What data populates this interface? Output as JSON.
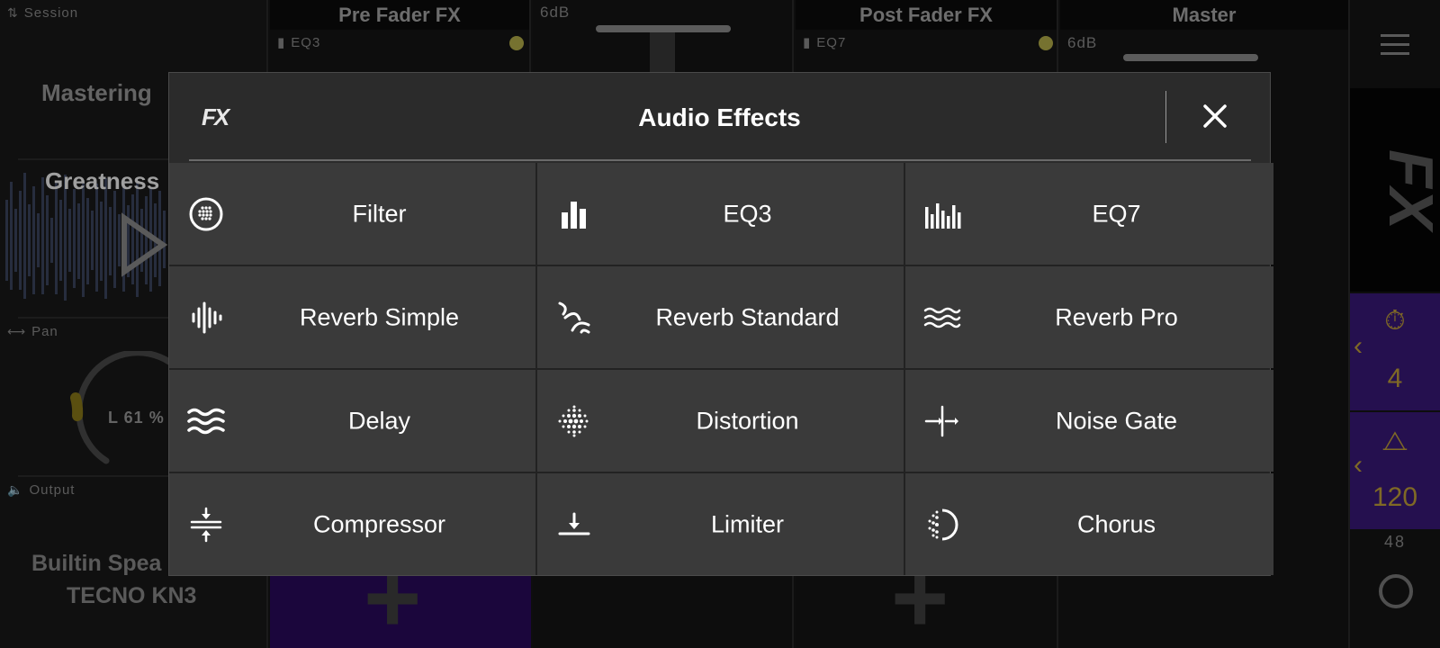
{
  "background": {
    "session_label": "Session",
    "session_name": "Mastering",
    "track_name": "Greatness",
    "pan_label": "Pan",
    "pan_value": "L 61 %",
    "output_label": "Output",
    "output_line1": "Builtin Spea",
    "output_line2": "TECNO KN3",
    "channels": [
      {
        "title": "Pre Fader FX",
        "slot_label": "EQ3"
      },
      {
        "db": "6dB"
      },
      {
        "title": "Post Fader FX",
        "slot_label": "EQ7"
      },
      {
        "title": "Master",
        "db": "6dB"
      }
    ],
    "rail": {
      "timer_value": "4",
      "tempo_value": "120",
      "small_value": "48"
    }
  },
  "modal": {
    "logo": "FX",
    "title": "Audio Effects",
    "close_icon": "close-icon",
    "effects": [
      {
        "label": "Filter",
        "icon": "filter-icon"
      },
      {
        "label": "EQ3",
        "icon": "eq3-icon"
      },
      {
        "label": "EQ7",
        "icon": "eq7-icon"
      },
      {
        "label": "Reverb Simple",
        "icon": "reverb-simple-icon"
      },
      {
        "label": "Reverb Standard",
        "icon": "reverb-standard-icon"
      },
      {
        "label": "Reverb Pro",
        "icon": "reverb-pro-icon"
      },
      {
        "label": "Delay",
        "icon": "delay-icon"
      },
      {
        "label": "Distortion",
        "icon": "distortion-icon"
      },
      {
        "label": "Noise Gate",
        "icon": "noise-gate-icon"
      },
      {
        "label": "Compressor",
        "icon": "compressor-icon"
      },
      {
        "label": "Limiter",
        "icon": "limiter-icon"
      },
      {
        "label": "Chorus",
        "icon": "chorus-icon"
      }
    ]
  },
  "colors": {
    "accent_gold": "#c4a23a",
    "purple": "#3a1a7a",
    "cell_bg": "#3a3a3a"
  }
}
